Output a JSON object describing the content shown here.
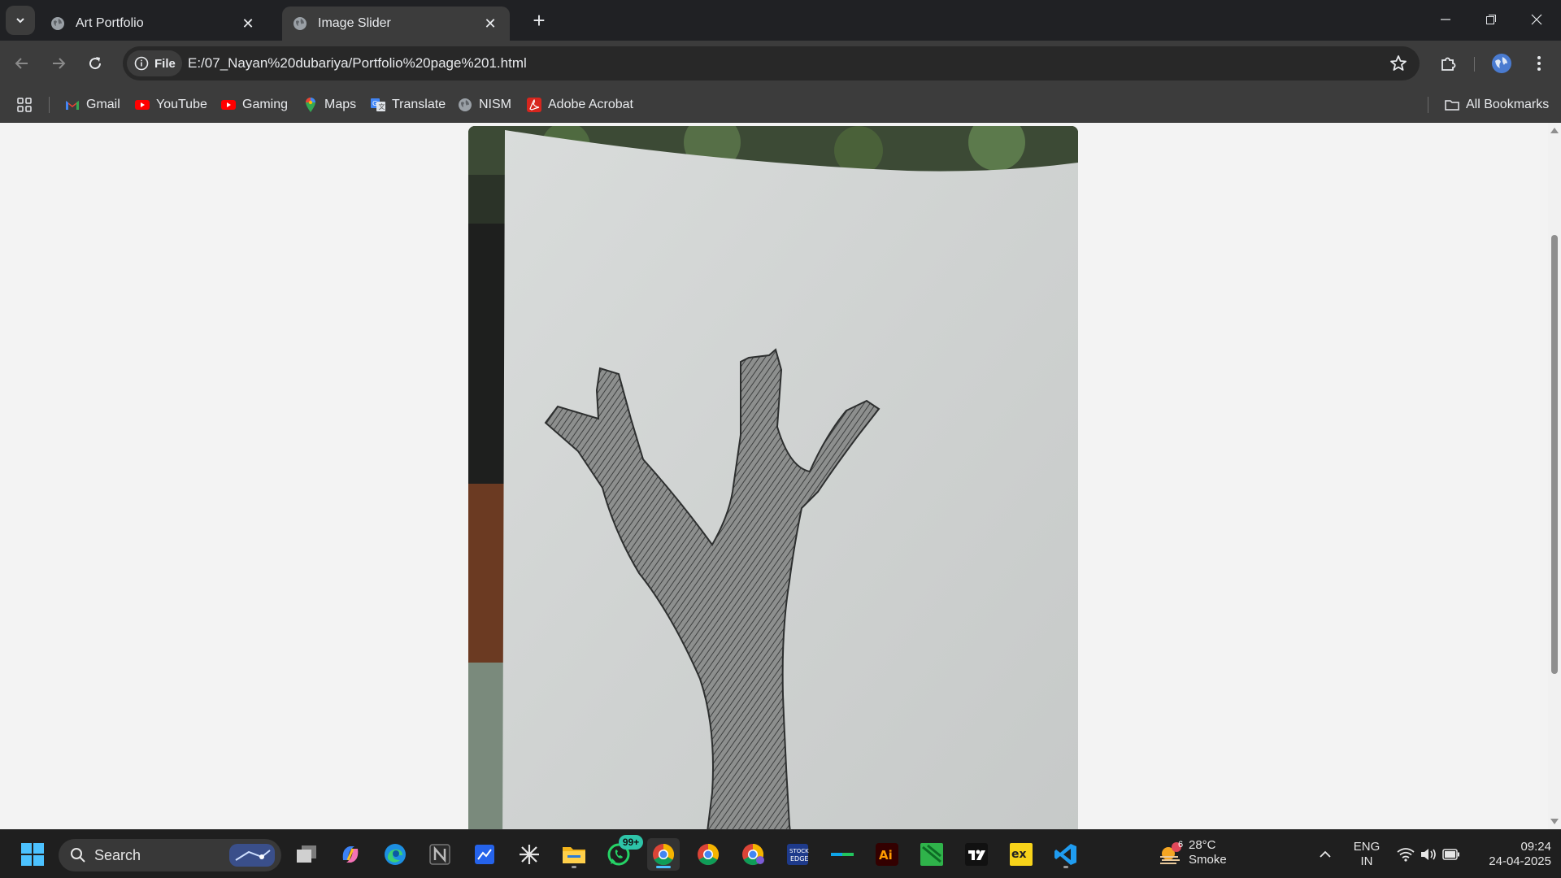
{
  "browser": {
    "tabs": [
      {
        "title": "Art Portfolio",
        "active": false
      },
      {
        "title": "Image Slider",
        "active": true
      }
    ],
    "address": {
      "scheme_chip": "File",
      "url": "E:/07_Nayan%20dubariya/Portfolio%20page%201.html"
    },
    "bookmarks": [
      {
        "label": "Gmail",
        "icon": "gmail-icon"
      },
      {
        "label": "YouTube",
        "icon": "youtube-icon"
      },
      {
        "label": "Gaming",
        "icon": "youtube-gaming-icon"
      },
      {
        "label": "Maps",
        "icon": "maps-icon"
      },
      {
        "label": "Translate",
        "icon": "translate-icon"
      },
      {
        "label": "NISM",
        "icon": "globe-icon"
      },
      {
        "label": "Adobe Acrobat",
        "icon": "acrobat-icon"
      }
    ],
    "all_bookmarks": "All Bookmarks"
  },
  "page": {
    "image_subject": "pencil sketch of a tree trunk with branches"
  },
  "taskbar": {
    "search_placeholder": "Search",
    "whatsapp_badge": "99+",
    "weather": {
      "badge": "6",
      "temp": "28°C",
      "condition": "Smoke"
    },
    "language": {
      "line1": "ENG",
      "line2": "IN"
    },
    "clock": {
      "time": "09:24",
      "date": "24-04-2025"
    }
  },
  "colors": {
    "tab_strip": "#202124",
    "toolbar": "#3c3c3c",
    "page_background": "#f3f3f3",
    "taskbar": "#1f1f1f",
    "accent": "#4cc2ff"
  }
}
